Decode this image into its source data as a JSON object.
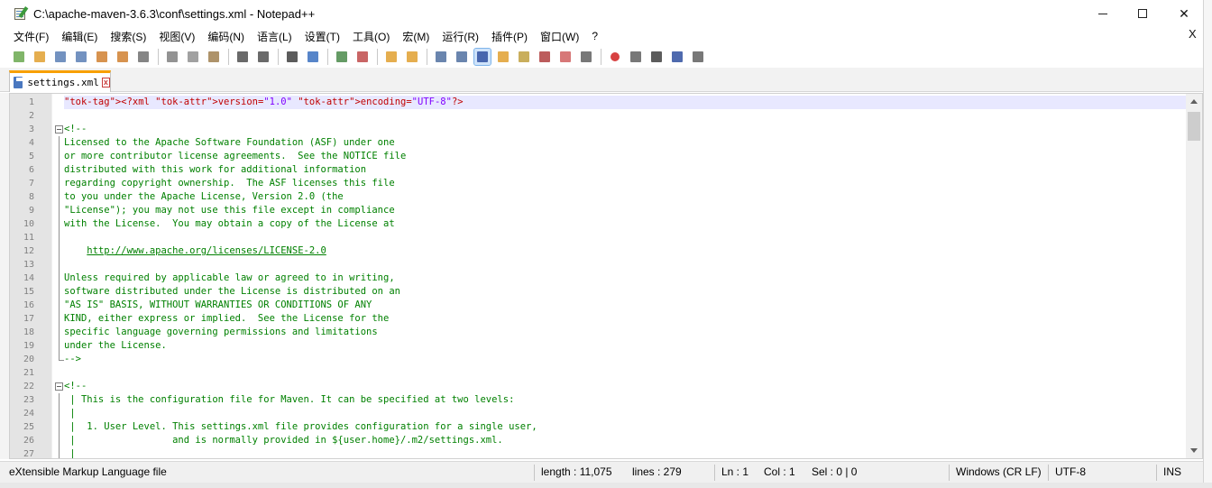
{
  "window": {
    "title": "C:\\apache-maven-3.6.3\\conf\\settings.xml - Notepad++",
    "minimize": "",
    "maximize": "",
    "close": "✕"
  },
  "menu": {
    "items": [
      "文件(F)",
      "编辑(E)",
      "搜索(S)",
      "视图(V)",
      "编码(N)",
      "语言(L)",
      "设置(T)",
      "工具(O)",
      "宏(M)",
      "运行(R)",
      "插件(P)",
      "窗口(W)",
      "?"
    ],
    "close_doc": "X"
  },
  "toolbar": {
    "icons": [
      {
        "name": "new-file-icon",
        "color": "#6aa84f"
      },
      {
        "name": "open-file-icon",
        "color": "#e0a030"
      },
      {
        "name": "save-icon",
        "color": "#5a7fb5"
      },
      {
        "name": "save-all-icon",
        "color": "#5a7fb5"
      },
      {
        "name": "close-file-icon",
        "color": "#d08030"
      },
      {
        "name": "close-all-icon",
        "color": "#d08030"
      },
      {
        "name": "print-icon",
        "color": "#707070"
      },
      {
        "sep": true
      },
      {
        "name": "cut-icon",
        "color": "#808080"
      },
      {
        "name": "copy-icon",
        "color": "#909090"
      },
      {
        "name": "paste-icon",
        "color": "#a08050"
      },
      {
        "sep": true
      },
      {
        "name": "undo-icon",
        "color": "#505050"
      },
      {
        "name": "redo-icon",
        "color": "#505050"
      },
      {
        "sep": true
      },
      {
        "name": "find-icon",
        "color": "#404040"
      },
      {
        "name": "replace-icon",
        "color": "#3a70c0"
      },
      {
        "sep": true
      },
      {
        "name": "zoom-in-icon",
        "color": "#4a8a4a"
      },
      {
        "name": "zoom-out-icon",
        "color": "#c04a4a"
      },
      {
        "sep": true
      },
      {
        "name": "sync-vertical-icon",
        "color": "#e0a030"
      },
      {
        "name": "sync-horizontal-icon",
        "color": "#e0a030"
      },
      {
        "sep": true
      },
      {
        "name": "word-wrap-icon",
        "color": "#5070a0"
      },
      {
        "name": "show-all-chars-icon",
        "color": "#5070a0"
      },
      {
        "name": "indent-guide-icon",
        "color": "#3050a0",
        "active": true
      },
      {
        "name": "define-language-icon",
        "color": "#e0a030"
      },
      {
        "name": "document-map-icon",
        "color": "#c0a040"
      },
      {
        "name": "function-list-icon",
        "color": "#b04040"
      },
      {
        "name": "folder-workspace-icon",
        "color": "#d06060"
      },
      {
        "name": "monitoring-icon",
        "color": "#606060"
      },
      {
        "sep": true
      },
      {
        "name": "record-macro-icon",
        "color": "#d02020",
        "round": true
      },
      {
        "name": "stop-macro-icon",
        "color": "#606060"
      },
      {
        "name": "play-macro-icon",
        "color": "#404040"
      },
      {
        "name": "run-macro-multiple-icon",
        "color": "#3050a0"
      },
      {
        "name": "save-macro-icon",
        "color": "#606060"
      }
    ]
  },
  "tab": {
    "label": "settings.xml",
    "close": "x"
  },
  "editor": {
    "lines": [
      {
        "n": "1",
        "text": "<?xml version=\"1.0\" encoding=\"UTF-8\"?>",
        "kind": "decl",
        "current": true
      },
      {
        "n": "2",
        "text": "",
        "kind": "plain"
      },
      {
        "n": "3",
        "text": "<!--",
        "kind": "comment",
        "fold": "start"
      },
      {
        "n": "4",
        "text": "Licensed to the Apache Software Foundation (ASF) under one",
        "kind": "comment",
        "fold": "mid"
      },
      {
        "n": "5",
        "text": "or more contributor license agreements.  See the NOTICE file",
        "kind": "comment",
        "fold": "mid"
      },
      {
        "n": "6",
        "text": "distributed with this work for additional information",
        "kind": "comment",
        "fold": "mid"
      },
      {
        "n": "7",
        "text": "regarding copyright ownership.  The ASF licenses this file",
        "kind": "comment",
        "fold": "mid"
      },
      {
        "n": "8",
        "text": "to you under the Apache License, Version 2.0 (the",
        "kind": "comment",
        "fold": "mid"
      },
      {
        "n": "9",
        "text": "\"License\"); you may not use this file except in compliance",
        "kind": "comment",
        "fold": "mid"
      },
      {
        "n": "10",
        "text": "with the License.  You may obtain a copy of the License at",
        "kind": "comment",
        "fold": "mid"
      },
      {
        "n": "11",
        "text": "",
        "kind": "comment",
        "fold": "mid"
      },
      {
        "n": "12",
        "text": "    http://www.apache.org/licenses/LICENSE-2.0",
        "kind": "link",
        "fold": "mid"
      },
      {
        "n": "13",
        "text": "",
        "kind": "comment",
        "fold": "mid"
      },
      {
        "n": "14",
        "text": "Unless required by applicable law or agreed to in writing,",
        "kind": "comment",
        "fold": "mid"
      },
      {
        "n": "15",
        "text": "software distributed under the License is distributed on an",
        "kind": "comment",
        "fold": "mid"
      },
      {
        "n": "16",
        "text": "\"AS IS\" BASIS, WITHOUT WARRANTIES OR CONDITIONS OF ANY",
        "kind": "comment",
        "fold": "mid"
      },
      {
        "n": "17",
        "text": "KIND, either express or implied.  See the License for the",
        "kind": "comment",
        "fold": "mid"
      },
      {
        "n": "18",
        "text": "specific language governing permissions and limitations",
        "kind": "comment",
        "fold": "mid"
      },
      {
        "n": "19",
        "text": "under the License.",
        "kind": "comment",
        "fold": "mid"
      },
      {
        "n": "20",
        "text": "-->",
        "kind": "comment",
        "fold": "end"
      },
      {
        "n": "21",
        "text": "",
        "kind": "plain"
      },
      {
        "n": "22",
        "text": "<!--",
        "kind": "comment",
        "fold": "start"
      },
      {
        "n": "23",
        "text": " | This is the configuration file for Maven. It can be specified at two levels:",
        "kind": "comment",
        "fold": "mid"
      },
      {
        "n": "24",
        "text": " |",
        "kind": "comment",
        "fold": "mid"
      },
      {
        "n": "25",
        "text": " |  1. User Level. This settings.xml file provides configuration for a single user,",
        "kind": "comment",
        "fold": "mid"
      },
      {
        "n": "26",
        "text": " |                 and is normally provided in ${user.home}/.m2/settings.xml.",
        "kind": "comment",
        "fold": "mid"
      },
      {
        "n": "27",
        "text": " |",
        "kind": "comment",
        "fold": "mid"
      }
    ]
  },
  "status": {
    "language": "eXtensible Markup Language file",
    "length": "length : 11,075",
    "lines": "lines : 279",
    "ln": "Ln : 1",
    "col": "Col : 1",
    "sel": "Sel : 0 | 0",
    "eol": "Windows (CR LF)",
    "encoding": "UTF-8",
    "mode": "INS"
  }
}
